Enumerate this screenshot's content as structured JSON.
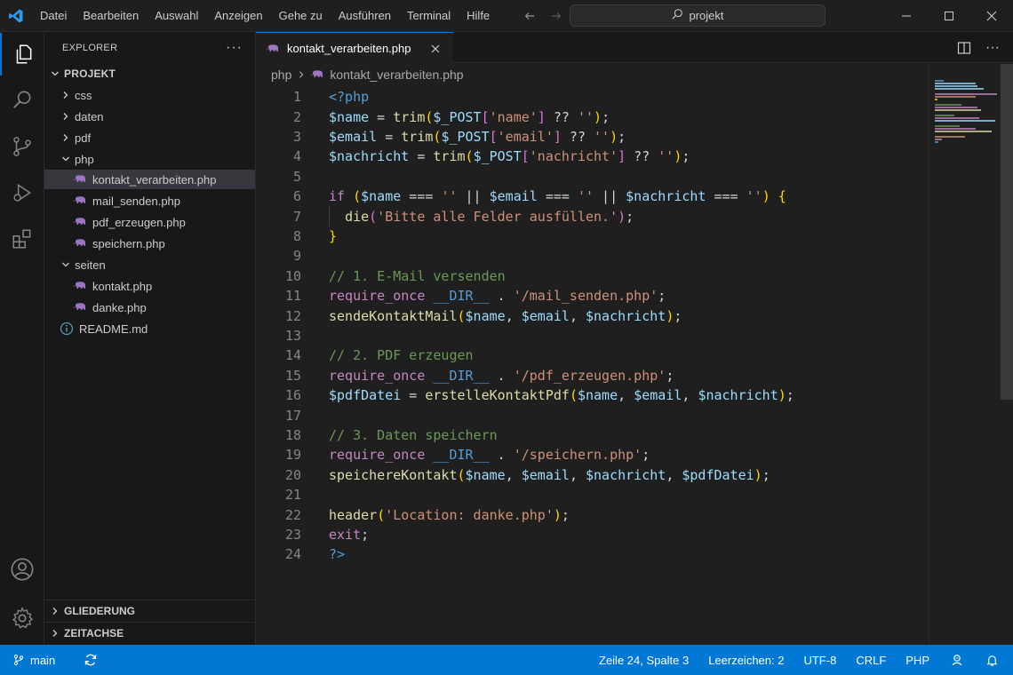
{
  "titlebar": {
    "menu": [
      "Datei",
      "Bearbeiten",
      "Auswahl",
      "Anzeigen",
      "Gehe zu",
      "Ausführen",
      "Terminal",
      "Hilfe"
    ],
    "search_text": "projekt"
  },
  "sidebar": {
    "title": "EXPLORER",
    "project": "PROJEKT",
    "tree": [
      {
        "label": "css",
        "kind": "folder",
        "expanded": false
      },
      {
        "label": "daten",
        "kind": "folder",
        "expanded": false
      },
      {
        "label": "pdf",
        "kind": "folder",
        "expanded": false
      },
      {
        "label": "php",
        "kind": "folder",
        "expanded": true
      },
      {
        "label": "kontakt_verarbeiten.php",
        "kind": "php",
        "selected": true
      },
      {
        "label": "mail_senden.php",
        "kind": "php"
      },
      {
        "label": "pdf_erzeugen.php",
        "kind": "php"
      },
      {
        "label": "speichern.php",
        "kind": "php"
      },
      {
        "label": "seiten",
        "kind": "folder",
        "expanded": true
      },
      {
        "label": "kontakt.php",
        "kind": "php"
      },
      {
        "label": "danke.php",
        "kind": "php"
      },
      {
        "label": "README.md",
        "kind": "info"
      }
    ],
    "outline": "GLIEDERUNG",
    "timeline": "ZEITACHSE"
  },
  "editor": {
    "tab_label": "kontakt_verarbeiten.php",
    "breadcrumb_folder": "php",
    "breadcrumb_file": "kontakt_verarbeiten.php",
    "line_count": 24
  },
  "statusbar": {
    "branch": "main",
    "position": "Zeile 24, Spalte 3",
    "indent": "Leerzeichen: 2",
    "encoding": "UTF-8",
    "eol": "CRLF",
    "language": "PHP"
  },
  "colors": {
    "accent": "#0078d4",
    "php_icon": "#a074c4"
  }
}
